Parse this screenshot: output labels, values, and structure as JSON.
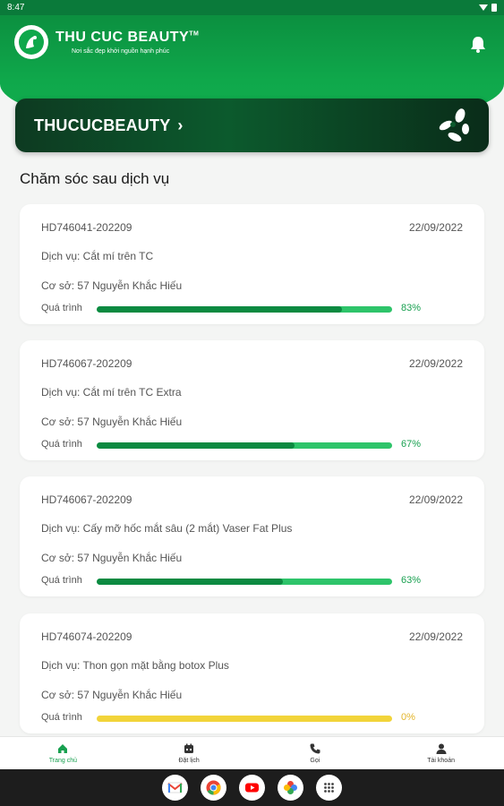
{
  "status_bar": {
    "time": "8:47"
  },
  "header": {
    "brand_name": "THU CUC BEAUTY",
    "brand_tm": "TM",
    "slogan": "Nơi sắc đẹp khởi nguồn hạnh phúc"
  },
  "banner": {
    "title": "THUCUCBEAUTY",
    "chevron": "›"
  },
  "section": {
    "title": "Chăm sóc sau dịch vụ"
  },
  "cards": [
    {
      "code": "HD746041-202209",
      "date": "22/09/2022",
      "service": "Dịch vụ: Cắt mí trên TC",
      "location": "Cơ sở: 57 Nguyễn Khắc Hiếu",
      "progress_label": "Quá trình",
      "progress": 83,
      "progress_text": "83%",
      "color": "green"
    },
    {
      "code": "HD746067-202209",
      "date": "22/09/2022",
      "service": "Dịch vụ: Cắt mí trên TC Extra",
      "location": "Cơ sở: 57 Nguyễn Khắc Hiếu",
      "progress_label": "Quá trình",
      "progress": 67,
      "progress_text": "67%",
      "color": "green"
    },
    {
      "code": "HD746067-202209",
      "date": "22/09/2022",
      "service": "Dịch vụ: Cấy mỡ hốc mắt sâu (2 mắt) Vaser Fat Plus",
      "location": "Cơ sở: 57 Nguyễn Khắc Hiếu",
      "progress_label": "Quá trình",
      "progress": 63,
      "progress_text": "63%",
      "color": "green"
    },
    {
      "code": "HD746074-202209",
      "date": "22/09/2022",
      "service": "Dịch vụ: Thon gọn mặt bằng botox Plus",
      "location": "Cơ sở: 57 Nguyễn Khắc Hiếu",
      "progress_label": "Quá trình",
      "progress": 0,
      "progress_text": "0%",
      "color": "yellow"
    }
  ],
  "bottom_nav": [
    {
      "label": "Trang chủ",
      "icon": "home-icon",
      "active": true
    },
    {
      "label": "Đặt lịch",
      "icon": "calendar-icon",
      "active": false
    },
    {
      "label": "Gọi",
      "icon": "phone-icon",
      "active": false
    },
    {
      "label": "Tài khoản",
      "icon": "user-icon",
      "active": false
    }
  ],
  "dock": [
    "gmail-icon",
    "chrome-icon",
    "youtube-icon",
    "photos-icon",
    "apps-icon"
  ],
  "colors": {
    "primary": "#0fa84b",
    "dark": "#0c5a2d",
    "progress_fill": "#0c8a41",
    "progress_track": "#2ec46a",
    "warning": "#f2d43a"
  }
}
